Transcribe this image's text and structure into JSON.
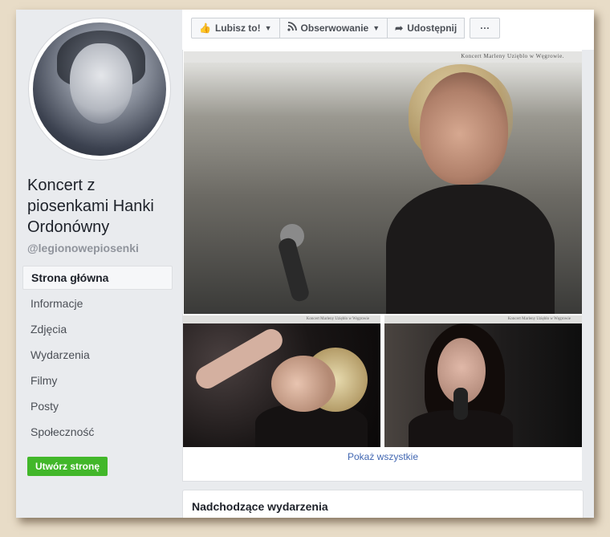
{
  "profile": {
    "title": "Koncert z piosenkami Hanki Ordonówny",
    "handle": "@legionowepiosenki"
  },
  "nav": {
    "items": [
      {
        "label": "Strona główna"
      },
      {
        "label": "Informacje"
      },
      {
        "label": "Zdjęcia"
      },
      {
        "label": "Wydarzenia"
      },
      {
        "label": "Filmy"
      },
      {
        "label": "Posty"
      },
      {
        "label": "Społeczność"
      }
    ]
  },
  "create_page_label": "Utwórz stronę",
  "actions": {
    "like": "Lubisz to!",
    "follow": "Obserwowanie",
    "share": "Udostępnij",
    "more": "···"
  },
  "photos": {
    "main_caption": "Koncert Marleny Uzięblo w Węgrowie.",
    "sub_caption": "Koncert Marleny Uzięblo w Węgrowie",
    "show_all": "Pokaż wszystkie"
  },
  "events": {
    "title": "Nadchodzące wydarzenia"
  },
  "colors": {
    "accent": "#4267b2",
    "green": "#42b72a",
    "background": "#e9ebee"
  }
}
